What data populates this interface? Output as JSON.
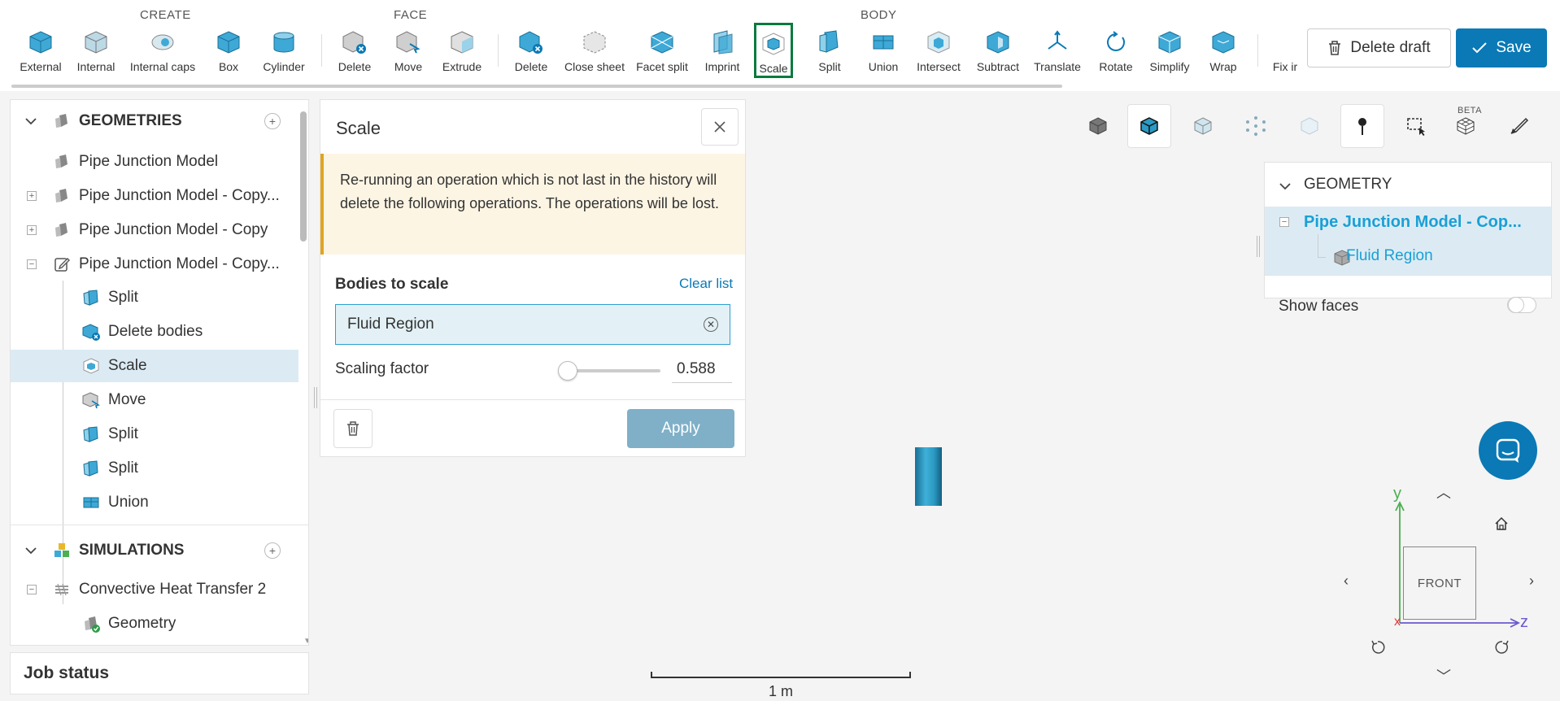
{
  "toolbar": {
    "groups": {
      "create": "CREATE",
      "face": "FACE",
      "body": "BODY"
    },
    "create_tools": [
      "External",
      "Internal",
      "Internal caps",
      "Box",
      "Cylinder"
    ],
    "face_tools": [
      "Delete",
      "Move",
      "Extrude"
    ],
    "body_tools": [
      "Delete",
      "Close sheet",
      "Facet split",
      "Imprint",
      "Scale",
      "Split",
      "Union",
      "Intersect",
      "Subtract",
      "Translate",
      "Rotate",
      "Simplify",
      "Wrap",
      "Fix ir"
    ],
    "selected_tool": "Scale",
    "delete_draft": "Delete draft",
    "save": "Save"
  },
  "tree": {
    "geometries_header": "GEOMETRIES",
    "geometries": [
      {
        "label": "Pipe Junction Model"
      },
      {
        "label": "Pipe Junction Model - Copy..."
      },
      {
        "label": "Pipe Junction Model - Copy"
      },
      {
        "label": "Pipe Junction Model - Copy..."
      }
    ],
    "operations": [
      {
        "label": "Split"
      },
      {
        "label": "Delete bodies"
      },
      {
        "label": "Scale"
      },
      {
        "label": "Move"
      },
      {
        "label": "Split"
      },
      {
        "label": "Split"
      },
      {
        "label": "Union"
      }
    ],
    "simulations_header": "SIMULATIONS",
    "simulation": "Convective Heat Transfer 2",
    "sim_child": "Geometry"
  },
  "job_status": "Job status",
  "scale_panel": {
    "title": "Scale",
    "warning": "Re-running an operation which is not last in the history will delete the following operations. The operations will be lost.",
    "bodies_label": "Bodies to scale",
    "clear_list": "Clear list",
    "bodies_value": "Fluid Region",
    "scaling_label": "Scaling factor",
    "scaling_value": "0.588",
    "apply": "Apply"
  },
  "geometry_panel": {
    "header": "GEOMETRY",
    "model": "Pipe Junction Model - Cop...",
    "body": "Fluid Region",
    "show_faces": "Show faces",
    "beta": "BETA"
  },
  "viewport": {
    "scale_label": "1 m",
    "view_face": "FRONT",
    "axis_y": "y",
    "axis_z": "z",
    "axis_x": "x"
  },
  "colors": {
    "accent": "#0a79b5",
    "selected_tool_border": "#0a7a3e",
    "highlight": "#1aa0d6"
  }
}
